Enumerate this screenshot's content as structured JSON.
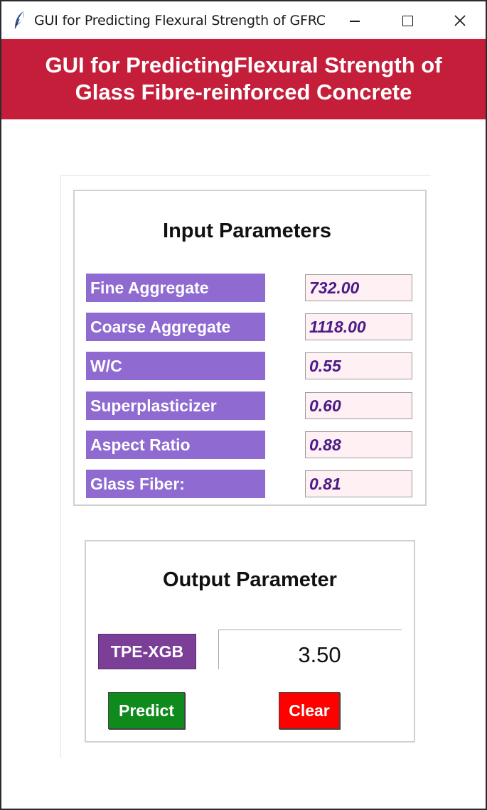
{
  "window": {
    "title": "GUI for Predicting Flexural Strength of GFRC"
  },
  "header": {
    "line1": "GUI for PredictingFlexural Strength of",
    "line2": "Glass Fibre-reinforced Concrete",
    "background_color": "#c41e3a"
  },
  "input_section": {
    "title": "Input Parameters",
    "parameters": [
      {
        "label": "Fine Aggregate",
        "value": "732.00"
      },
      {
        "label": "Coarse Aggregate",
        "value": "1118.00"
      },
      {
        "label": "W/C",
        "value": "0.55"
      },
      {
        "label": "Superplasticizer",
        "value": "0.60"
      },
      {
        "label": "Aspect Ratio",
        "value": "0.88"
      },
      {
        "label": "Glass Fiber:",
        "value": "0.81"
      }
    ],
    "label_color": "#8e6ad1",
    "value_color": "#4b1b87"
  },
  "output_section": {
    "title": "Output Parameter",
    "model_label": "TPE-XGB",
    "result_value": "3.50",
    "predict_label": "Predict",
    "clear_label": "Clear",
    "predict_color": "#0f8a1d",
    "clear_color": "#ff0000"
  },
  "icons": {
    "app_icon": "feather-icon",
    "minimize": "minimize-icon",
    "maximize": "maximize-icon",
    "close": "close-icon"
  }
}
